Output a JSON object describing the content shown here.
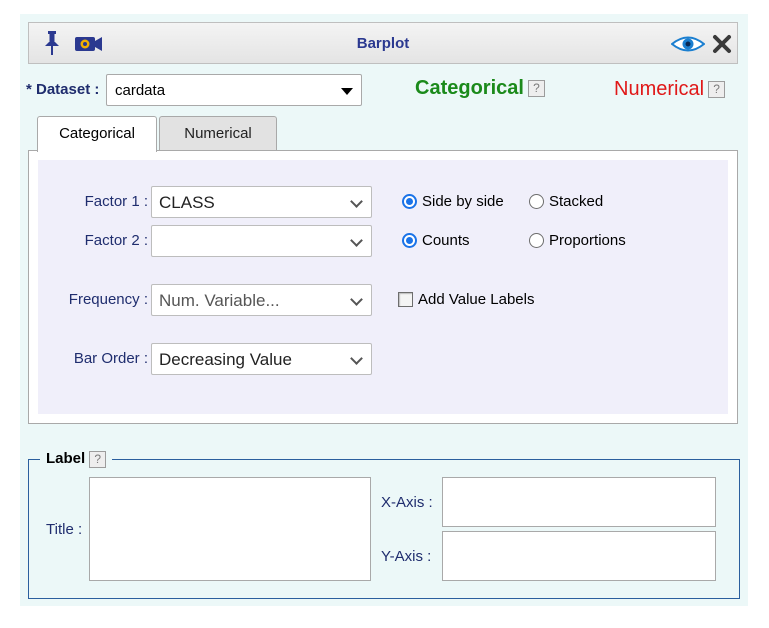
{
  "window": {
    "title": "Barplot",
    "icons": [
      "pin-icon",
      "video-camera-icon",
      "eye-icon",
      "close-icon"
    ]
  },
  "dataset": {
    "label": "* Dataset :",
    "value": "cardata"
  },
  "headings": {
    "categorical": "Categorical",
    "numerical": "Numerical",
    "help_glyph": "?"
  },
  "tabs": [
    {
      "label": "Categorical",
      "active": true
    },
    {
      "label": "Numerical",
      "active": false
    }
  ],
  "fields": {
    "factor1": {
      "label": "Factor 1 :",
      "value": "CLASS"
    },
    "factor2": {
      "label": "Factor 2 :",
      "value": ""
    },
    "frequency": {
      "label": "Frequency :",
      "placeholder": "Num. Variable..."
    },
    "bar_order": {
      "label": "Bar Order :",
      "value": "Decreasing Value"
    }
  },
  "options": {
    "layout": [
      {
        "label": "Side by side",
        "checked": true
      },
      {
        "label": "Stacked",
        "checked": false
      }
    ],
    "measure": [
      {
        "label": "Counts",
        "checked": true
      },
      {
        "label": "Proportions",
        "checked": false
      }
    ],
    "value_labels": {
      "label": "Add Value Labels",
      "checked": false
    }
  },
  "label_section": {
    "legend": "Label",
    "title_label": "Title :",
    "xaxis_label": "X-Axis :",
    "yaxis_label": "Y-Axis :"
  },
  "colors": {
    "title_blue": "#2b3990",
    "categorical_green": "#1b8a1b",
    "numerical_red": "#e01818",
    "radio_blue": "#1a73e8",
    "panel_bg": "#ecf8f8"
  }
}
